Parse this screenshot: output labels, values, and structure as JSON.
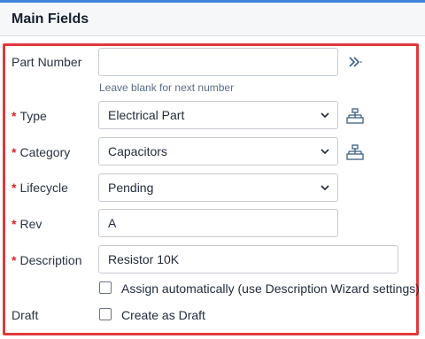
{
  "section": {
    "title": "Main Fields"
  },
  "fields": {
    "part_number": {
      "label": "Part Number",
      "value": "",
      "hint": "Leave blank for next number",
      "action_icon": "double-chevron-right-icon"
    },
    "type": {
      "label": "Type",
      "value": "Electrical Part",
      "side_icon": "hierarchy-icon"
    },
    "category": {
      "label": "Category",
      "value": "Capacitors",
      "side_icon": "hierarchy-icon"
    },
    "lifecycle": {
      "label": "Lifecycle",
      "value": "Pending"
    },
    "rev": {
      "label": "Rev",
      "value": "A"
    },
    "description": {
      "label": "Description",
      "value": "Resistor 10K"
    },
    "assign_auto": {
      "label": "Assign automatically (use Description Wizard settings)",
      "checked": false
    },
    "draft": {
      "label": "Draft",
      "checkbox_label": "Create as Draft",
      "checked": false
    }
  },
  "required_marker": "*",
  "colors": {
    "required": "#d6272d",
    "highlight_frame": "#e0393b",
    "accent": "#3d83d9"
  }
}
